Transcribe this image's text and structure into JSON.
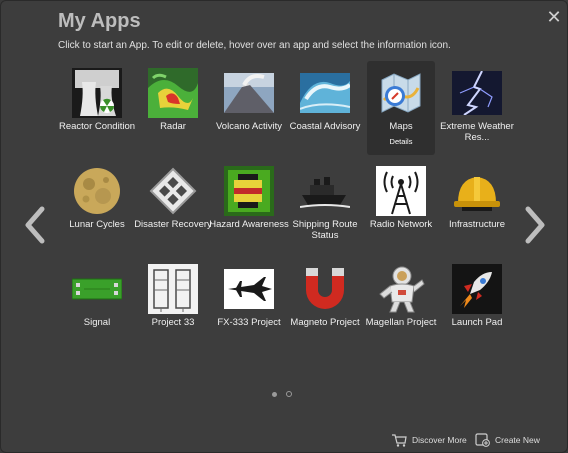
{
  "header": {
    "title": "My Apps",
    "subtitle": "Click to start an App. To edit or delete, hover over an app and select the information icon.",
    "close_icon": "close-icon"
  },
  "apps": [
    {
      "label": "Reactor Condition",
      "icon": "reactor-icon"
    },
    {
      "label": "Radar",
      "icon": "radar-icon"
    },
    {
      "label": "Volcano Activity",
      "icon": "volcano-icon"
    },
    {
      "label": "Coastal Advisory",
      "icon": "wave-icon"
    },
    {
      "label": "Maps",
      "icon": "maps-icon",
      "details": "Details"
    },
    {
      "label": "Extreme Weather Res...",
      "icon": "lightning-icon"
    },
    {
      "label": "Lunar Cycles",
      "icon": "moon-icon"
    },
    {
      "label": "Disaster Recovery",
      "icon": "disaster-recovery-icon"
    },
    {
      "label": "Hazard Awareness",
      "icon": "hazard-icon"
    },
    {
      "label": "Shipping Route Status",
      "icon": "ship-icon"
    },
    {
      "label": "Radio Network",
      "icon": "radio-tower-icon"
    },
    {
      "label": "Infrastructure",
      "icon": "hard-hat-icon"
    },
    {
      "label": "Signal",
      "icon": "signal-board-icon"
    },
    {
      "label": "Project 33",
      "icon": "blueprint-icon"
    },
    {
      "label": "FX-333 Project",
      "icon": "jet-icon"
    },
    {
      "label": "Magneto Project",
      "icon": "magnet-icon"
    },
    {
      "label": "Magellan Project",
      "icon": "astronaut-icon"
    },
    {
      "label": "Launch Pad",
      "icon": "rocket-icon"
    }
  ],
  "pagination": {
    "pages": 2,
    "current": 1
  },
  "footer": {
    "discover_label": "Discover More",
    "create_label": "Create New"
  }
}
